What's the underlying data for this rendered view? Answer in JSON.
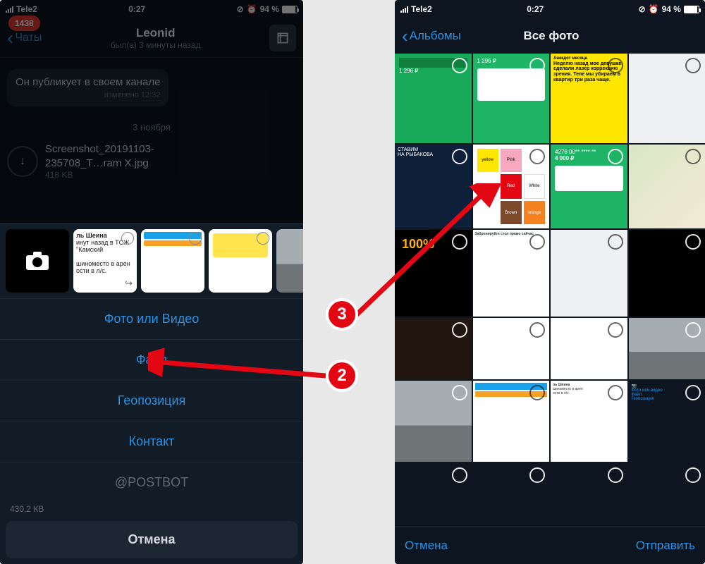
{
  "status": {
    "carrier": "Tele2",
    "time": "0:27",
    "battery_pct": "94 %"
  },
  "left": {
    "back_label": "Чаты",
    "unread_badge": "1438",
    "title": "Leonid",
    "subtitle": "был(а) 3 минуты назад",
    "bubble_text": "Он публикует в своем канале",
    "bubble_edited": "изменено 12:32",
    "date_sep": "3 ноября",
    "file_name_1": "Screenshot_20191103-",
    "file_name_2": "235708_T…ram X.jpg",
    "file_size": "418 KB",
    "truncated_size": "430,2 КВ",
    "thumb2_l1": "ль Шеина",
    "thumb2_l2": "инут назад в ТСЖ \"Камский",
    "thumb2_l3": "шиноместо в арен",
    "thumb2_l4": "ости в л/с.",
    "sheet": {
      "photo_video": "Фото или Видео",
      "file": "Файл",
      "location": "Геопозиция",
      "contact": "Контакт",
      "postbot": "@POSTBOT",
      "cancel": "Отмена"
    }
  },
  "right": {
    "albums": "Альбомы",
    "all_photos": "Все фото",
    "footer_cancel": "Отмена",
    "footer_send": "Отправить",
    "yellow_text": "Неделю назад мое девушке сделали лазер коррекцию зрения. Тепе мы убираем в квартир три раза чаще.",
    "yellow_header": "Анекдот месяца",
    "green1_amount": "1 296 ₽",
    "green2_card": "4276 00** **** **",
    "green2_amount": "4 000 ₽",
    "hundred": "100%",
    "zabron": "Забронируйте стол прямо сейчас",
    "sheina_l1": "ль Шеина",
    "sheina_l2": "шиноместо в арен",
    "sheina_l3": "ости в л/с.",
    "tg_photo": "Фото или видео",
    "tg_file": "Файл",
    "tg_loc": "Геопозиция"
  },
  "anno": {
    "n2": "2",
    "n3": "3"
  }
}
